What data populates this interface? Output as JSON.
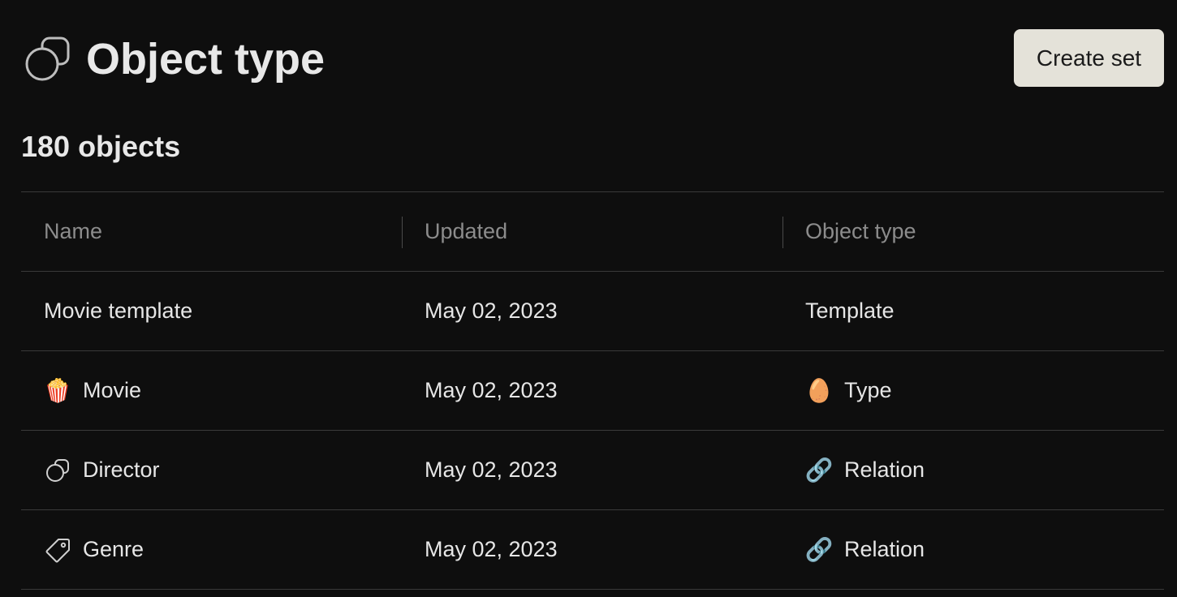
{
  "header": {
    "icon": "object-type-icon",
    "title": "Object type",
    "create_button_label": "Create set"
  },
  "summary": {
    "count_label": "180 objects"
  },
  "table": {
    "columns": [
      "Name",
      "Updated",
      "Object type"
    ],
    "rows": [
      {
        "name": "Movie template",
        "name_icon": "",
        "updated": "May 02, 2023",
        "object_type": "Template",
        "type_icon": ""
      },
      {
        "name": "Movie",
        "name_icon": "popcorn-icon",
        "name_icon_glyph": "🍿",
        "updated": "May 02, 2023",
        "object_type": "Type",
        "type_icon": "egg-icon",
        "type_icon_glyph": "🥚"
      },
      {
        "name": "Director",
        "name_icon": "object-type-icon",
        "updated": "May 02, 2023",
        "object_type": "Relation",
        "type_icon": "link-icon",
        "type_icon_glyph": "🔗"
      },
      {
        "name": "Genre",
        "name_icon": "tag-icon",
        "updated": "May 02, 2023",
        "object_type": "Relation",
        "type_icon": "link-icon",
        "type_icon_glyph": "🔗"
      }
    ]
  },
  "colors": {
    "background": "#0e0e0e",
    "button_bg": "#e4e2d9",
    "divider": "#3a3a3a",
    "muted_text": "#8c8c8c"
  }
}
